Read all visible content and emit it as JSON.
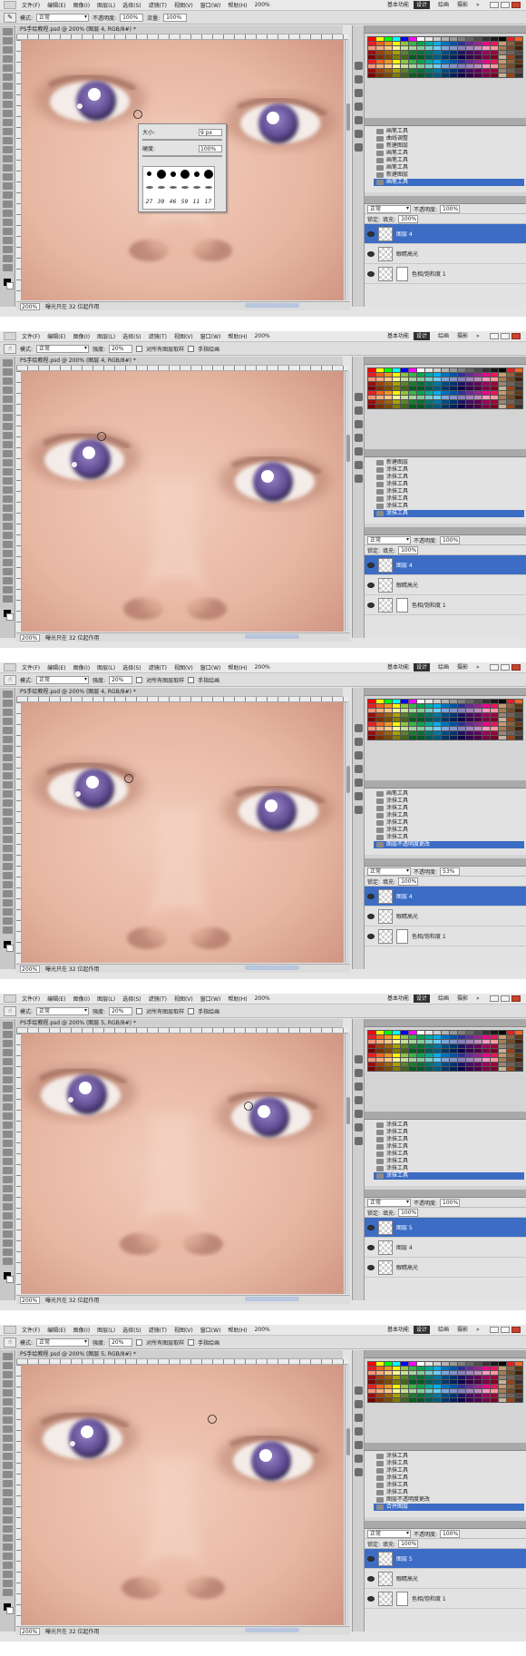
{
  "app": {
    "menu": [
      "文件(F)",
      "编辑(E)",
      "图像(I)",
      "图层(L)",
      "选择(S)",
      "滤镜(T)",
      "视图(V)",
      "窗口(W)",
      "帮助(H)"
    ],
    "zoom_menu_value": "200%",
    "workspaces": {
      "essentials": "基本功能",
      "design": "设计",
      "painting": "绘画",
      "photography": "摄影",
      "more": "»"
    }
  },
  "frames": [
    {
      "tool_icon": "brush-icon",
      "options": {
        "mode_label": "模式:",
        "mode": "正常",
        "opacity_label": "不透明度:",
        "opacity": "100%",
        "flow_label": "流量:",
        "flow": "100%"
      },
      "doc_title": "PS手绘教程.psd @ 200% (图层 4, RGB/8#) *",
      "status": {
        "zoom": "200%",
        "info": "曝光只在 32 位起作用"
      },
      "brush_popup": {
        "size_label": "大小:",
        "size_value": "9 px",
        "hardness_label": "硬度:",
        "hardness_value": "100%",
        "preset_numbers": [
          "27",
          "39",
          "46",
          "59",
          "11",
          "17"
        ]
      },
      "history": [
        "画笔工具",
        "曲线调整",
        "新建图层",
        "画笔工具",
        "画笔工具",
        "画笔工具",
        "新建图层",
        "画笔工具"
      ],
      "history_selected": 7,
      "layers": {
        "blend": "正常",
        "opacity_label": "不透明度:",
        "opacity": "100%",
        "fill_label": "填充:",
        "fill": "100%",
        "lock_label": "锁定:",
        "rows": [
          {
            "name": "图层 4",
            "selected": true,
            "mask": false
          },
          {
            "name": "眼睛高光",
            "selected": false,
            "mask": false
          },
          {
            "name": "色相/饱和度 1",
            "selected": false,
            "mask": true
          }
        ]
      }
    },
    {
      "tool_icon": "smudge-icon",
      "options": {
        "mode_label": "模式:",
        "mode": "正常",
        "strength_label": "强度:",
        "strength": "20%",
        "sample_label": "对所有图层取样",
        "finger_label": "手指绘画"
      },
      "doc_title": "PS手绘教程.psd @ 200% (图层 4, RGB/8#) *",
      "status": {
        "zoom": "200%",
        "info": "曝光只在 32 位起作用"
      },
      "history": [
        "新建图层",
        "涂抹工具",
        "涂抹工具",
        "涂抹工具",
        "涂抹工具",
        "涂抹工具",
        "涂抹工具",
        "涂抹工具"
      ],
      "history_selected": 7,
      "layers": {
        "blend": "正常",
        "opacity_label": "不透明度:",
        "opacity": "100%",
        "fill_label": "填充:",
        "fill": "100%",
        "lock_label": "锁定:",
        "rows": [
          {
            "name": "图层 4",
            "selected": true,
            "mask": false
          },
          {
            "name": "眼睛高光",
            "selected": false,
            "mask": false
          },
          {
            "name": "色相/饱和度 1",
            "selected": false,
            "mask": true
          }
        ]
      }
    },
    {
      "tool_icon": "smudge-icon",
      "options": {
        "mode_label": "模式:",
        "mode": "正常",
        "strength_label": "强度:",
        "strength": "20%",
        "sample_label": "对所有图层取样",
        "finger_label": "手指绘画"
      },
      "doc_title": "PS手绘教程.psd @ 200% (图层 4, RGB/8#) *",
      "status": {
        "zoom": "200%",
        "info": "曝光只在 32 位起作用"
      },
      "history": [
        "画笔工具",
        "涂抹工具",
        "涂抹工具",
        "涂抹工具",
        "涂抹工具",
        "涂抹工具",
        "涂抹工具",
        "图层不透明度更改"
      ],
      "history_selected": 7,
      "layers": {
        "blend": "正常",
        "opacity_label": "不透明度:",
        "opacity": "53%",
        "fill_label": "填充:",
        "fill": "100%",
        "lock_label": "锁定:",
        "rows": [
          {
            "name": "图层 4",
            "selected": true,
            "mask": false
          },
          {
            "name": "眼睛高光",
            "selected": false,
            "mask": false
          },
          {
            "name": "色相/饱和度 1",
            "selected": false,
            "mask": true
          }
        ]
      }
    },
    {
      "tool_icon": "smudge-icon",
      "options": {
        "mode_label": "模式:",
        "mode": "正常",
        "strength_label": "强度:",
        "strength": "20%",
        "sample_label": "对所有图层取样",
        "finger_label": "手指绘画"
      },
      "doc_title": "PS手绘教程.psd @ 200% (图层 5, RGB/8#) *",
      "status": {
        "zoom": "200%",
        "info": "曝光只在 32 位起作用"
      },
      "history": [
        "涂抹工具",
        "涂抹工具",
        "涂抹工具",
        "涂抹工具",
        "涂抹工具",
        "涂抹工具",
        "涂抹工具",
        "涂抹工具"
      ],
      "history_selected": 7,
      "layers": {
        "blend": "正常",
        "opacity_label": "不透明度:",
        "opacity": "100%",
        "fill_label": "填充:",
        "fill": "100%",
        "lock_label": "锁定:",
        "rows": [
          {
            "name": "图层 5",
            "selected": true,
            "mask": false
          },
          {
            "name": "图层 4",
            "selected": false,
            "mask": false
          },
          {
            "name": "眼睛高光",
            "selected": false,
            "mask": false
          }
        ]
      }
    },
    {
      "tool_icon": "smudge-icon",
      "options": {
        "mode_label": "模式:",
        "mode": "正常",
        "strength_label": "强度:",
        "strength": "20%",
        "sample_label": "对所有图层取样",
        "finger_label": "手指绘画"
      },
      "doc_title": "PS手绘教程.psd @ 200% (图层 5, RGB/8#) *",
      "status": {
        "zoom": "200%",
        "info": "曝光只在 32 位起作用"
      },
      "history": [
        "涂抹工具",
        "涂抹工具",
        "涂抹工具",
        "涂抹工具",
        "涂抹工具",
        "涂抹工具",
        "图层不透明度更改",
        "合并图层"
      ],
      "history_selected": 7,
      "layers": {
        "blend": "正常",
        "opacity_label": "不透明度:",
        "opacity": "100%",
        "fill_label": "填充:",
        "fill": "100%",
        "lock_label": "锁定:",
        "rows": [
          {
            "name": "图层 5",
            "selected": true,
            "mask": false
          },
          {
            "name": "眼睛高光",
            "selected": false,
            "mask": false
          },
          {
            "name": "色相/饱和度 1",
            "selected": false,
            "mask": true
          }
        ]
      }
    }
  ]
}
